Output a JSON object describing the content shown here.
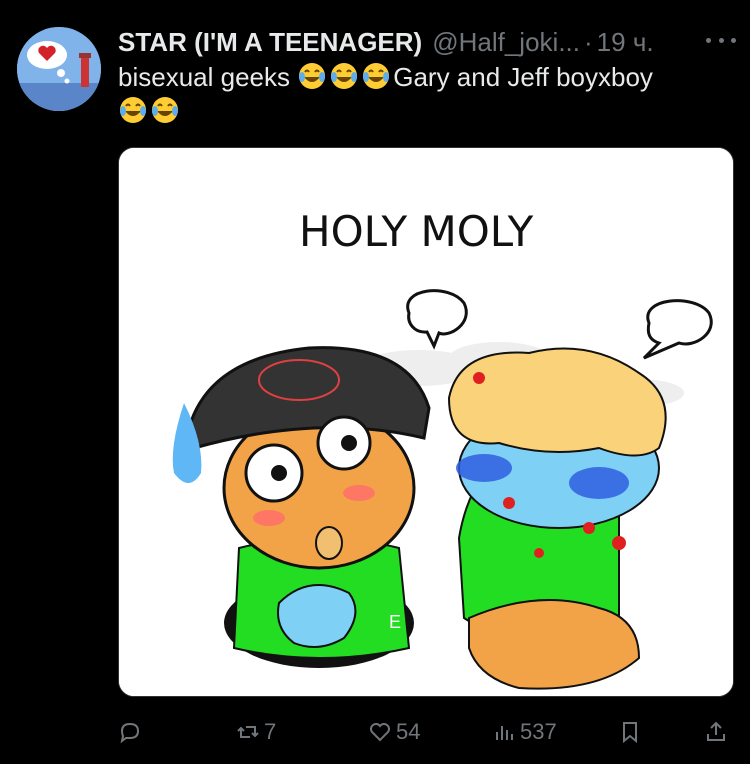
{
  "user": {
    "display_name": "STAR (I'M A TEENAGER)",
    "handle": "@Half_joki...",
    "separator": "·",
    "time": "19 ч."
  },
  "tweet": {
    "text_1": "bisexual geeks ",
    "text_2": "Gary and Jeff boyxboy"
  },
  "drawing": {
    "caption": "HOLY MOLY"
  },
  "actions": {
    "reposts": "7",
    "likes": "54",
    "views": "537"
  },
  "icons": {
    "reply": "speech-bubble-icon",
    "repost": "repost-arrows-icon",
    "like": "heart-outline-icon",
    "views": "bar-chart-icon",
    "bookmark": "bookmark-icon",
    "share": "share-upload-icon",
    "more": "ellipsis-icon",
    "emoji": "face-with-tears-of-joy"
  },
  "colors": {
    "background": "#000000",
    "text": "#e7e9ea",
    "secondary_text": "#71767b"
  }
}
